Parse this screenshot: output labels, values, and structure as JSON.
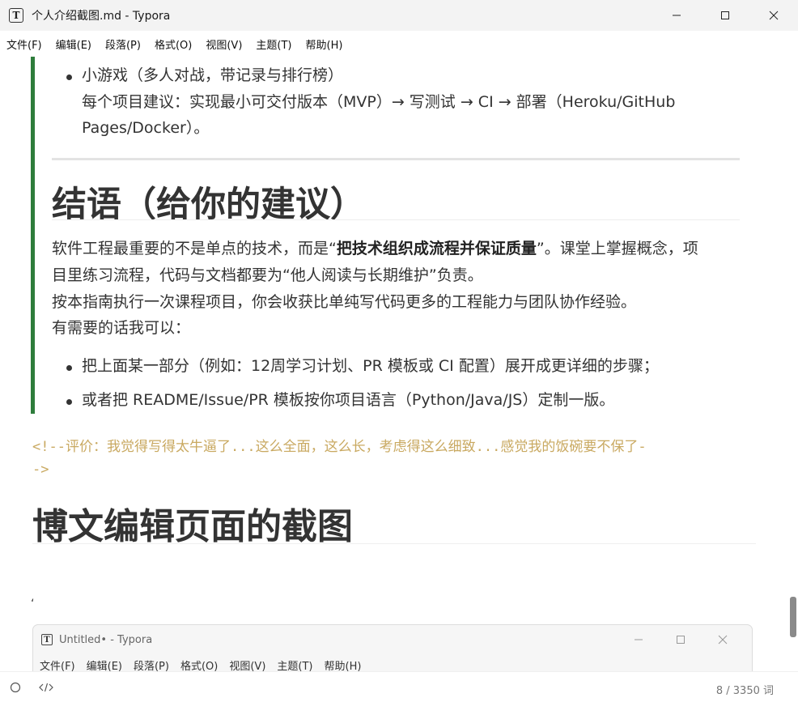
{
  "window": {
    "title": "个人介绍截图.md - Typora",
    "app_icon": "T"
  },
  "menu": [
    "文件(F)",
    "编辑(E)",
    "段落(P)",
    "格式(O)",
    "视图(V)",
    "主题(T)",
    "帮助(H)"
  ],
  "doc": {
    "list_item_top": "小游戏（多人对战，带记录与排行榜）",
    "project_line1": " 每个项目建议：实现最小可交付版本（MVP）→ 写测试 → CI → 部署（Heroku/GitHub",
    "project_line2": "Pages/Docker）。",
    "conclusion_heading": "结语（给你的建议）",
    "para1_prefix": "软件工程最重要的不是单点的技术，而是“",
    "para1_bold": "把技术组织成流程并保证质量",
    "para1_suffix": "”。课堂上掌握概念，项",
    "para2": "目里练习流程，代码与文档都要为“他人阅读与长期维护”负责。",
    "para3": " 按本指南执行一次课程项目，你会收获比单纯写代码更多的工程能力与团队协作经验。",
    "para4": " 有需要的话我可以：",
    "bullet1": "把上面某一部分（例如：12周学习计划、PR 模板或 CI 配置）展开成更详细的步骤；",
    "bullet2": "或者把 README/Issue/PR 模板按你项目语言（Python/Java/JS）定制一版。",
    "comment_line1": "<!--评价：我觉得写得太牛逼了...这么全面，这么长，考虑得这么细致...感觉我的饭碗要不保了-",
    "comment_line2": "->",
    "section_heading": "博文编辑页面的截图",
    "stray_mark": "‘"
  },
  "embedded_screenshot": {
    "title": "Untitled• - Typora",
    "app_icon": "T",
    "menu": [
      "文件(F)",
      "编辑(E)",
      "段落(P)",
      "格式(O)",
      "视图(V)",
      "主题(T)",
      "帮助(H)"
    ]
  },
  "status": {
    "word_count": "8 / 3350 词",
    "icons": [
      "outline-circle-icon",
      "source-code-icon"
    ]
  },
  "colors": {
    "quote_bar": "#2e7d3c",
    "comment": "#c9a961",
    "text": "#333333"
  }
}
